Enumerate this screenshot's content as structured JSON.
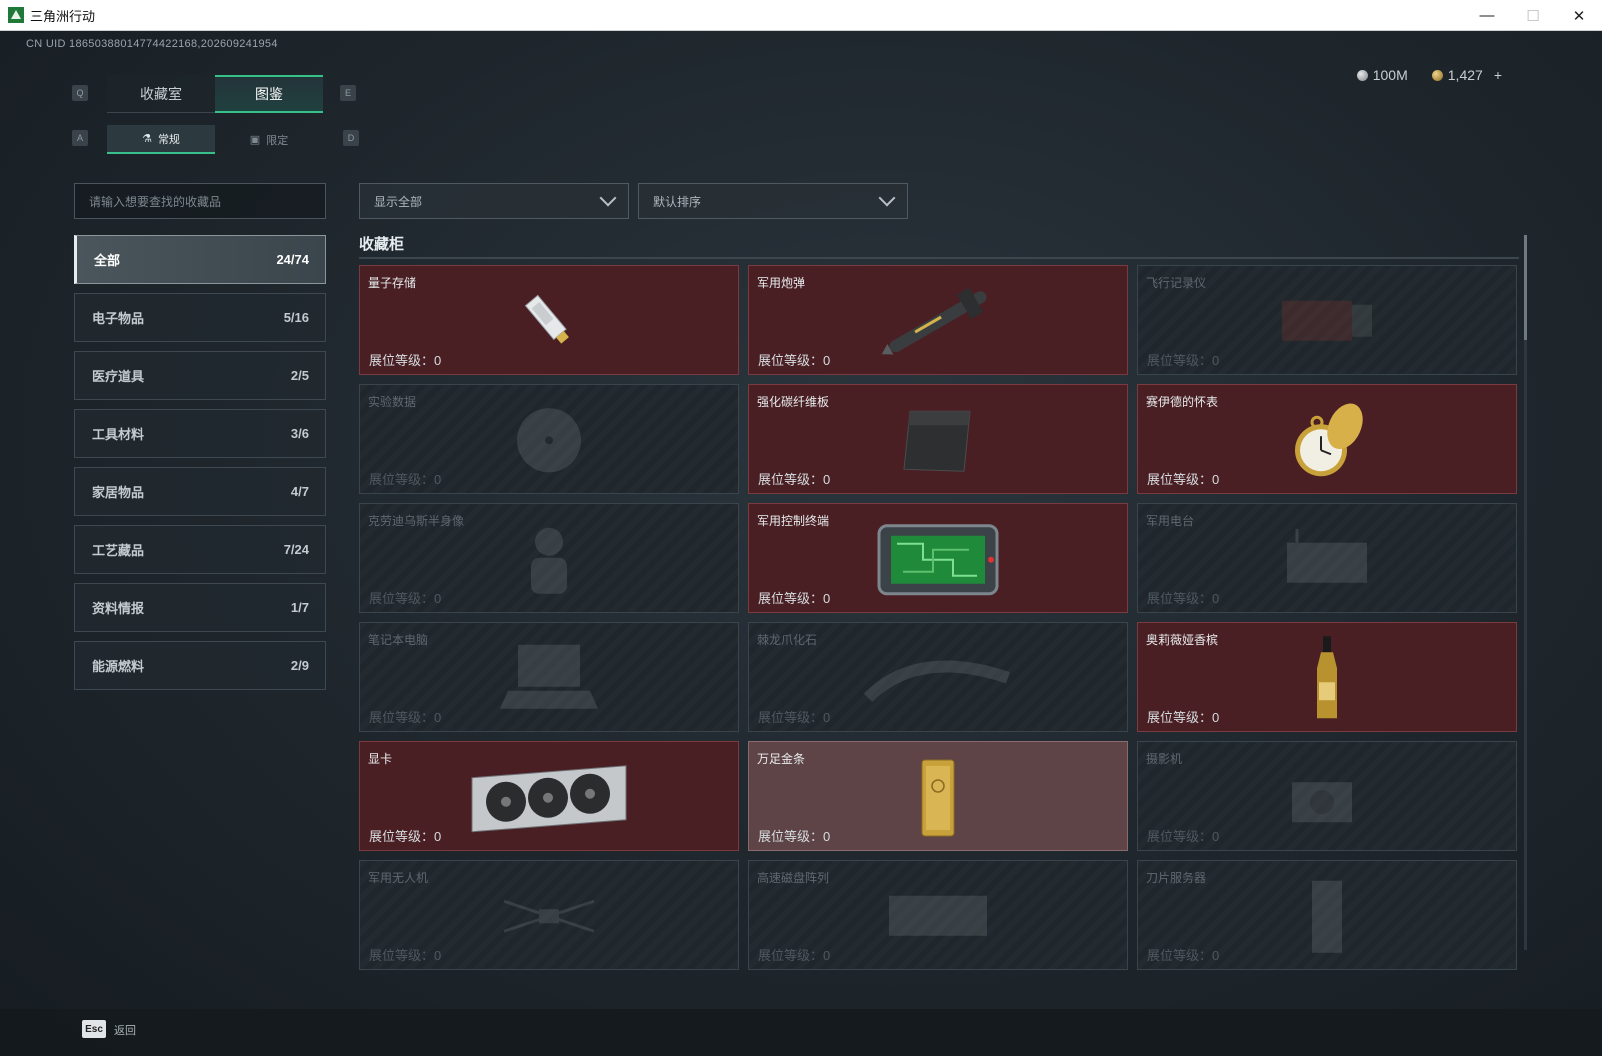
{
  "window": {
    "title": "三角洲行动"
  },
  "uid": "CN UID 18650388014774422168,202609241954",
  "currency": {
    "silver": "100M",
    "gold": "1,427",
    "add": "+"
  },
  "keys": {
    "prev_tab": "Q",
    "next_tab": "E",
    "prev_sub": "A",
    "next_sub": "D"
  },
  "tabs": [
    {
      "label": "收藏室"
    },
    {
      "label": "图鉴"
    }
  ],
  "subtabs": [
    {
      "label": "常规"
    },
    {
      "label": "限定"
    }
  ],
  "search": {
    "placeholder": "请输入想要查找的收藏品"
  },
  "filters": {
    "show": "显示全部",
    "sort": "默认排序"
  },
  "categories": [
    {
      "label": "全部",
      "count": "24/74"
    },
    {
      "label": "电子物品",
      "count": "5/16"
    },
    {
      "label": "医疗道具",
      "count": "2/5"
    },
    {
      "label": "工具材料",
      "count": "3/6"
    },
    {
      "label": "家居物品",
      "count": "4/7"
    },
    {
      "label": "工艺藏品",
      "count": "7/24"
    },
    {
      "label": "资料情报",
      "count": "1/7"
    },
    {
      "label": "能源燃料",
      "count": "2/9"
    }
  ],
  "section": {
    "title": "收藏柜"
  },
  "items": [
    {
      "name": "量子存储",
      "level": "展位等级：0",
      "state": "owned",
      "icon": "usb-drive-icon"
    },
    {
      "name": "军用炮弹",
      "level": "展位等级：0",
      "state": "owned",
      "icon": "missile-icon"
    },
    {
      "name": "飞行记录仪",
      "level": "展位等级：0",
      "state": "locked",
      "icon": "flight-recorder-icon"
    },
    {
      "name": "实验数据",
      "level": "展位等级：0",
      "state": "locked",
      "icon": "disc-icon"
    },
    {
      "name": "强化碳纤维板",
      "level": "展位等级：0",
      "state": "owned",
      "icon": "carbon-plate-icon"
    },
    {
      "name": "赛伊德的怀表",
      "level": "展位等级：0",
      "state": "owned",
      "icon": "pocket-watch-icon"
    },
    {
      "name": "克劳迪乌斯半身像",
      "level": "展位等级：0",
      "state": "locked",
      "icon": "bust-icon"
    },
    {
      "name": "军用控制终端",
      "level": "展位等级：0",
      "state": "owned",
      "icon": "control-terminal-icon"
    },
    {
      "name": "军用电台",
      "level": "展位等级：0",
      "state": "locked",
      "icon": "radio-icon"
    },
    {
      "name": "笔记本电脑",
      "level": "展位等级：0",
      "state": "locked",
      "icon": "laptop-icon"
    },
    {
      "name": "棘龙爪化石",
      "level": "展位等级：0",
      "state": "locked",
      "icon": "fossil-claw-icon"
    },
    {
      "name": "奥莉薇娅香槟",
      "level": "展位等级：0",
      "state": "owned",
      "icon": "champagne-icon"
    },
    {
      "name": "显卡",
      "level": "展位等级：0",
      "state": "owned",
      "icon": "graphics-card-icon"
    },
    {
      "name": "万足金条",
      "level": "展位等级：0",
      "state": "special",
      "icon": "gold-bar-icon"
    },
    {
      "name": "摄影机",
      "level": "展位等级：0",
      "state": "locked",
      "icon": "camera-icon"
    },
    {
      "name": "军用无人机",
      "level": "展位等级：0",
      "state": "locked",
      "icon": "drone-icon"
    },
    {
      "name": "高速磁盘阵列",
      "level": "展位等级：0",
      "state": "locked",
      "icon": "disk-array-icon"
    },
    {
      "name": "刀片服务器",
      "level": "展位等级：0",
      "state": "locked",
      "icon": "blade-server-icon"
    }
  ],
  "footer": {
    "esc": "Esc",
    "back": "返回"
  },
  "colors": {
    "accent": "#37c08a",
    "owned": "#4a1f24",
    "special": "#5e4446"
  }
}
